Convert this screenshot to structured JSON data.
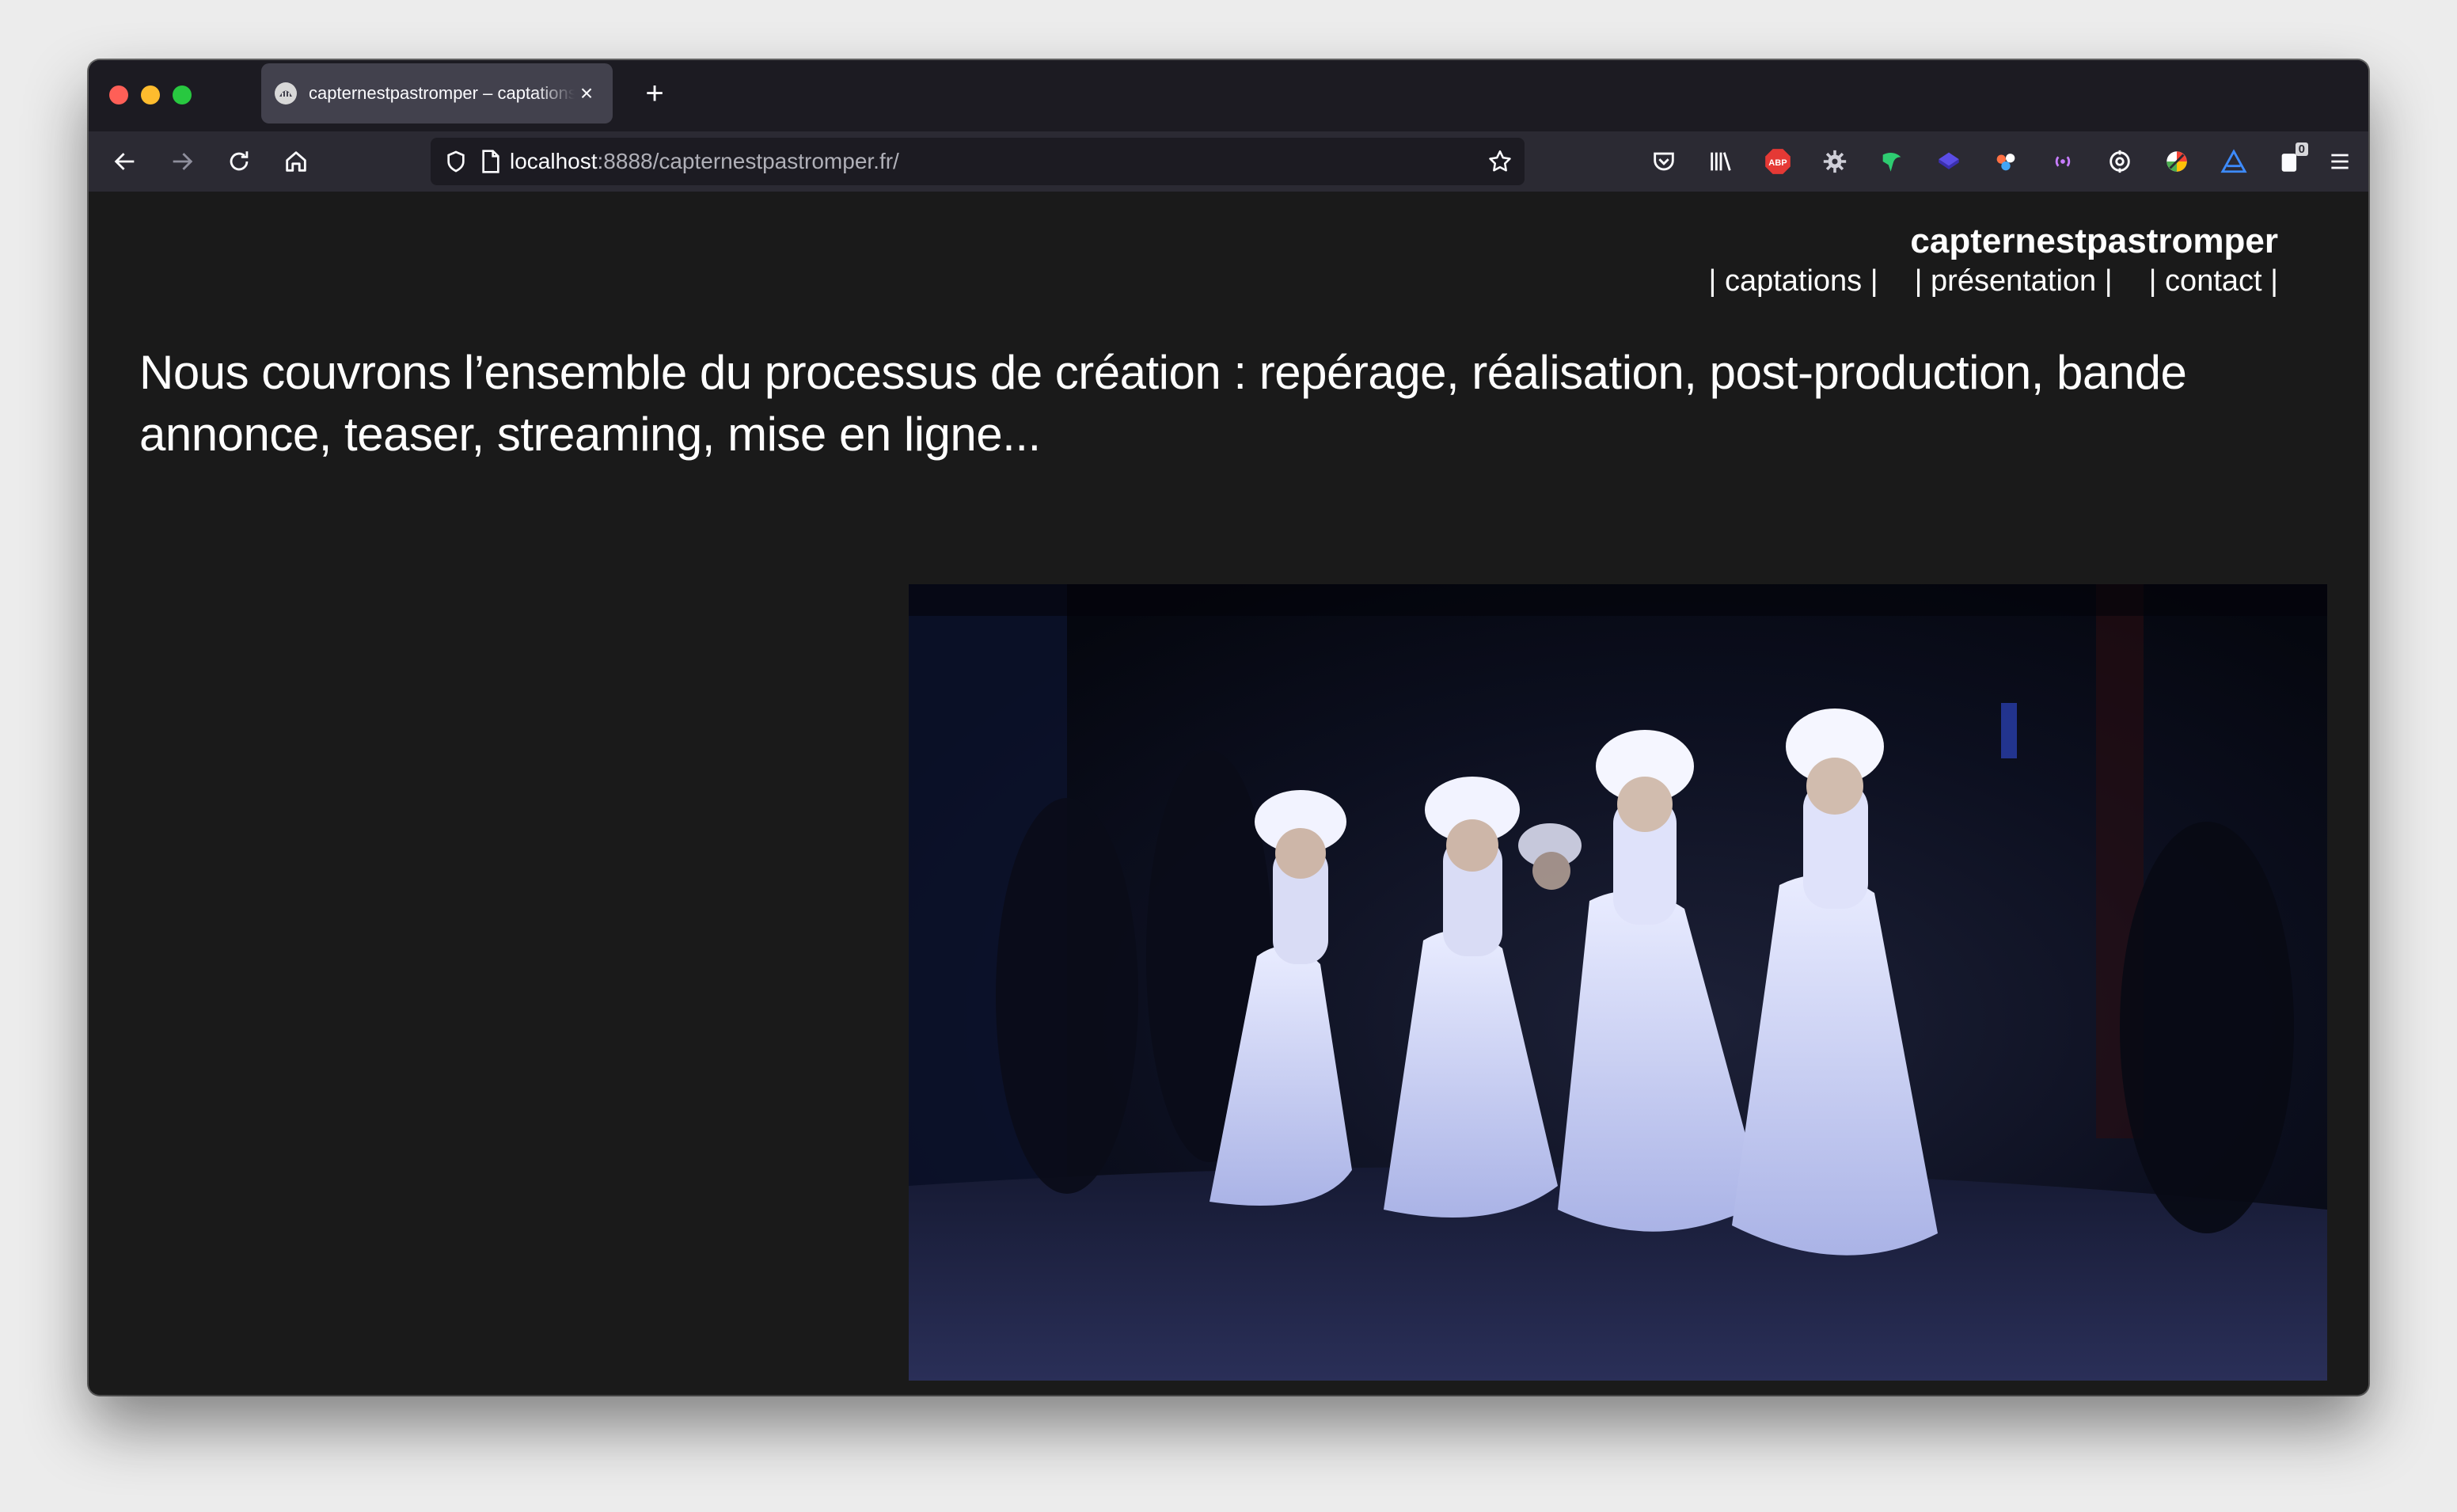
{
  "browser": {
    "tab_title": "capternestpastromper – captations",
    "tab_close": "×",
    "new_tab": "+",
    "url_host": "localhost",
    "url_path": ":8888/capternestpastromper.fr/",
    "extension_badge": "0",
    "icons": [
      "back-icon",
      "forward-icon",
      "reload-icon",
      "home-icon",
      "shield-icon",
      "page-icon",
      "star-icon",
      "pocket-icon",
      "library-icon",
      "adblock-icon",
      "gear-icon",
      "extension-icons",
      "menu-icon"
    ]
  },
  "site": {
    "title": "capternestpastromper",
    "nav": [
      "| captations |",
      "| présentation |",
      "| contact |"
    ],
    "intro": "Nous couvrons l’ensemble du processus de création : repérage, réalisation, post-production, bande annonce, teaser, streaming, mise en ligne..."
  },
  "colors": {
    "page_background": "#1a1a1a",
    "chrome_background": "#1c1b22",
    "toolbar_background": "#2b2a33",
    "text": "#ffffff"
  }
}
